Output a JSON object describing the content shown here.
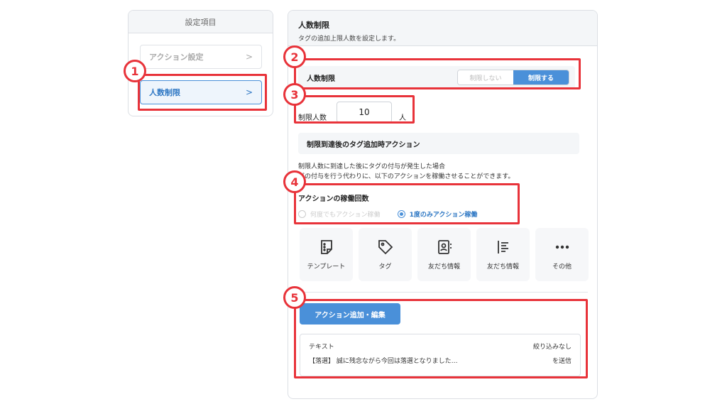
{
  "sidebar": {
    "header": "設定項目",
    "items": [
      {
        "label": "アクション設定",
        "active": false
      },
      {
        "label": "人数制限",
        "active": true
      }
    ]
  },
  "panel": {
    "title": "人数制限",
    "subtitle": "タグの追加上限人数を設定します。",
    "limit_row": {
      "label": "人数制限",
      "toggle_off": "制限しない",
      "toggle_on": "制限する",
      "selected": "制限する"
    },
    "count": {
      "label": "制限人数",
      "value": "10",
      "unit": "人"
    },
    "section_title": "制限到達後のタグ追加時アクション",
    "description_line1": "制限人数に到達した後にタグの付与が発生した場合",
    "description_line2": "グの付与を行う代わりに、以下のアクションを稼働させることができます。",
    "run_count": {
      "title": "アクションの稼働回数",
      "option_any": "何度でもアクション稼働",
      "option_once": "1度のみアクション稼働",
      "selected": "1度のみアクション稼働"
    },
    "action_tiles": [
      {
        "label": "テンプレート",
        "icon": "template-icon"
      },
      {
        "label": "タグ",
        "icon": "tag-icon"
      },
      {
        "label": "友だち情報",
        "icon": "contact-card-icon"
      },
      {
        "label": "友だち情報",
        "icon": "list-icon"
      },
      {
        "label": "その他",
        "icon": "more-icon"
      }
    ],
    "add_button": "アクション追加・編集",
    "action_card": {
      "type": "テキスト",
      "filter": "絞り込みなし",
      "content": "【落選】 誠に残念ながら今回は落選となりました…",
      "action": "を送信"
    }
  },
  "annotations": [
    "1",
    "2",
    "3",
    "4",
    "5"
  ],
  "colors": {
    "accent": "#4a90d9",
    "annotation": "#e8333a"
  }
}
